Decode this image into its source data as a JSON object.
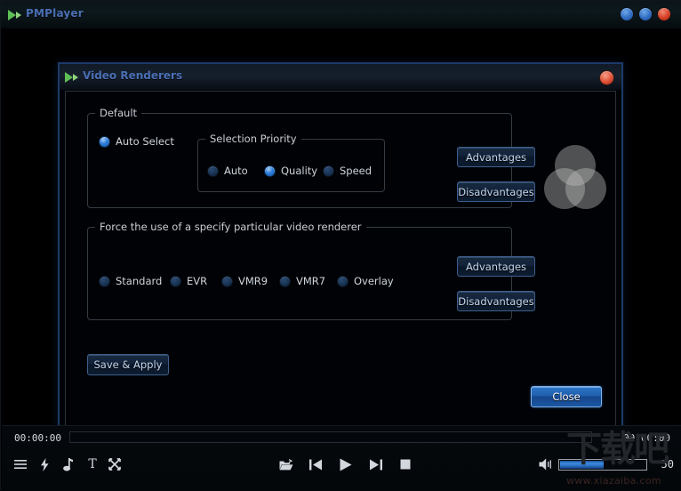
{
  "window": {
    "title": "PMPlayer",
    "icon": "play-triangle-icon",
    "buttons": [
      {
        "name": "minimize-button",
        "color": "#2f6cc0"
      },
      {
        "name": "maximize-button",
        "color": "#2f6cc0"
      },
      {
        "name": "close-button",
        "color": "#d33c22"
      }
    ]
  },
  "dialog": {
    "title": "Video Renderers",
    "icon": "play-triangle-icon",
    "close_label": "",
    "groups": {
      "default": {
        "label": "Default",
        "auto_select": {
          "label": "Auto Select",
          "selected": true
        },
        "priority": {
          "label": "Selection Priority",
          "options": [
            {
              "label": "Auto",
              "selected": false
            },
            {
              "label": "Quality",
              "selected": true
            },
            {
              "label": "Speed",
              "selected": false
            }
          ]
        },
        "advantages_label": "Advantages",
        "disadvantages_label": "Disadvantages"
      },
      "force": {
        "label": "Force the use of a specify particular video renderer",
        "options": [
          {
            "label": "Standard",
            "selected": false
          },
          {
            "label": "EVR",
            "selected": false
          },
          {
            "label": "VMR9",
            "selected": false
          },
          {
            "label": "VMR7",
            "selected": false
          },
          {
            "label": "Overlay",
            "selected": false
          }
        ],
        "advantages_label": "Advantages",
        "disadvantages_label": "Disadvantages"
      }
    },
    "save_label": "Save & Apply",
    "close_button_label": "Close"
  },
  "player": {
    "time_elapsed": "00:00:00",
    "time_total": "00:00:00",
    "seek_position_percent": 0,
    "left_icons": [
      {
        "name": "menu-icon"
      },
      {
        "name": "bolt-icon"
      },
      {
        "name": "music-note-icon"
      },
      {
        "name": "subtitle-text-icon",
        "glyph": "T"
      },
      {
        "name": "shuffle-icon"
      }
    ],
    "transport_icons": [
      {
        "name": "open-file-icon"
      },
      {
        "name": "previous-track-icon"
      },
      {
        "name": "play-icon"
      },
      {
        "name": "next-track-icon"
      },
      {
        "name": "stop-icon"
      }
    ],
    "volume": {
      "icon": "speaker-icon",
      "value": "50",
      "percent": 50
    }
  },
  "watermark": {
    "cn": "下载吧",
    "url": "www.xiazaiba.com"
  },
  "colors": {
    "accent_blue": "#2d7fdb",
    "title_blue": "#4a6fb5",
    "close_red": "#d33c22",
    "text": "#cfd5dd"
  }
}
